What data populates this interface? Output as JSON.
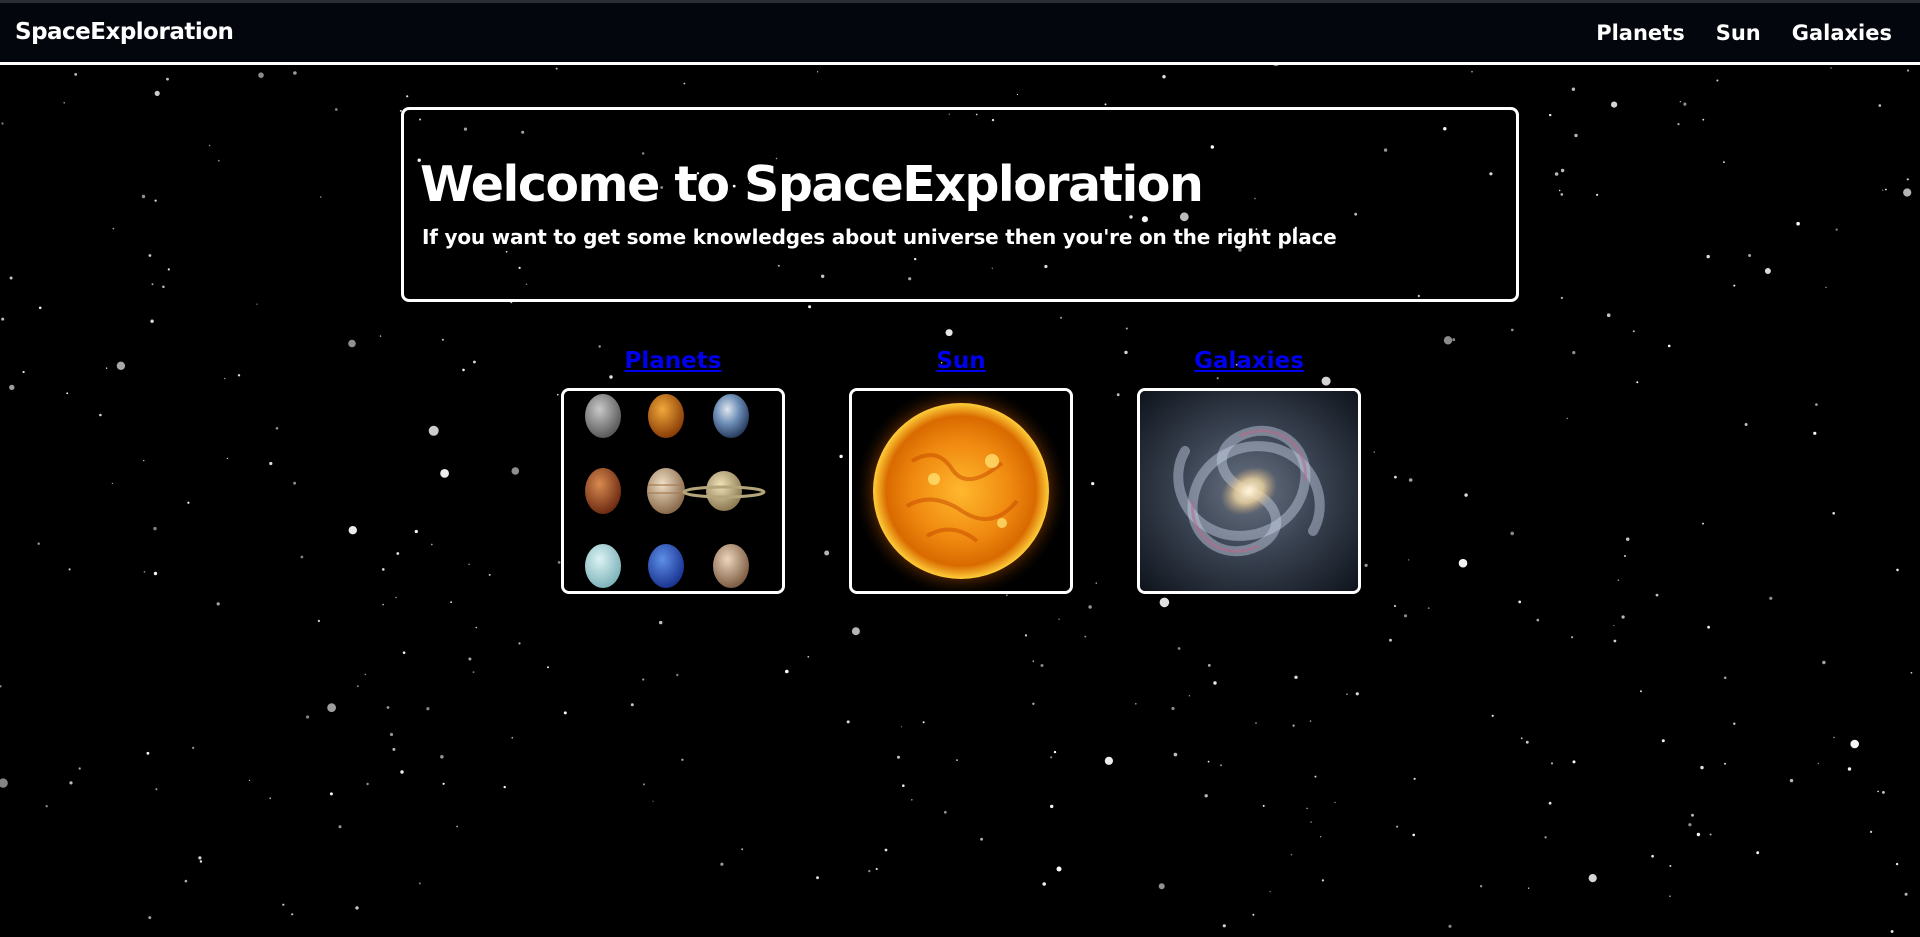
{
  "nav": {
    "brand": "SpaceExploration",
    "links": [
      "Planets",
      "Sun",
      "Galaxies"
    ]
  },
  "hero": {
    "title": "Welcome to SpaceExploration",
    "subtitle": "If you want to get some knowledges about universe then you're on the right place"
  },
  "cards": [
    {
      "title": "Planets",
      "image": "solar-system-planets-icon"
    },
    {
      "title": "Sun",
      "image": "sun-icon"
    },
    {
      "title": "Galaxies",
      "image": "spiral-galaxy-icon"
    }
  ],
  "colors": {
    "background": "#000000",
    "navbar": "#04060d",
    "border": "#ffffff",
    "text": "#ffffff"
  }
}
